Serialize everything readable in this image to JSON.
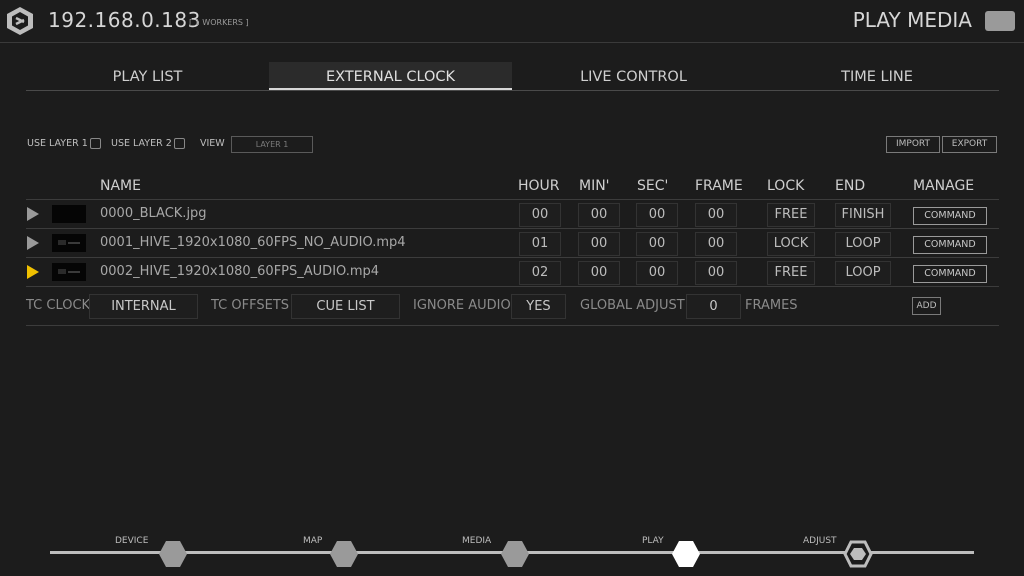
{
  "header": {
    "ip": "192.168.0.183",
    "workers": "[ 1 WORKERS ]",
    "mode": "PLAY MEDIA"
  },
  "tabs": [
    {
      "label": "PLAY LIST",
      "active": false
    },
    {
      "label": "EXTERNAL CLOCK",
      "active": true
    },
    {
      "label": "LIVE CONTROL",
      "active": false
    },
    {
      "label": "TIME LINE",
      "active": false
    }
  ],
  "options": {
    "use_layer_1": "USE LAYER 1",
    "use_layer_2": "USE LAYER 2",
    "view_label": "VIEW",
    "view_value": "LAYER 1",
    "import": "IMPORT",
    "export": "EXPORT"
  },
  "table": {
    "headers": {
      "name": "NAME",
      "hour": "HOUR",
      "min": "MIN'",
      "sec": "SEC'",
      "frame": "FRAME",
      "lock": "LOCK",
      "end": "END",
      "manage": "MANAGE"
    },
    "rows": [
      {
        "name": "0000_BLACK.jpg",
        "hour": "00",
        "min": "00",
        "sec": "00",
        "frame": "00",
        "lock": "FREE",
        "end": "FINISH",
        "manage": "COMMAND",
        "active": false
      },
      {
        "name": "0001_HIVE_1920x1080_60FPS_NO_AUDIO.mp4",
        "hour": "01",
        "min": "00",
        "sec": "00",
        "frame": "00",
        "lock": "LOCK",
        "end": "LOOP",
        "manage": "COMMAND",
        "active": false
      },
      {
        "name": "0002_HIVE_1920x1080_60FPS_AUDIO.mp4",
        "hour": "02",
        "min": "00",
        "sec": "00",
        "frame": "00",
        "lock": "FREE",
        "end": "LOOP",
        "manage": "COMMAND",
        "active": true
      }
    ]
  },
  "footer": {
    "tc_clock_label": "TC CLOCK",
    "tc_clock_value": "INTERNAL",
    "tc_offsets_label": "TC OFFSETS",
    "tc_offsets_value": "CUE LIST",
    "ignore_audio_label": "IGNORE AUDIO",
    "ignore_audio_value": "YES",
    "global_adjust_label": "GLOBAL ADJUST",
    "global_adjust_value": "0",
    "frames_label": "FRAMES",
    "add": "ADD"
  },
  "nav": [
    {
      "label": "DEVICE",
      "state": "inactive"
    },
    {
      "label": "MAP",
      "state": "inactive"
    },
    {
      "label": "MEDIA",
      "state": "inactive"
    },
    {
      "label": "PLAY",
      "state": "active"
    },
    {
      "label": "ADJUST",
      "state": "outline"
    }
  ],
  "colors": {
    "background": "#1c1c1c",
    "accent_play": "#f0c000",
    "text": "#c8c8c8"
  }
}
